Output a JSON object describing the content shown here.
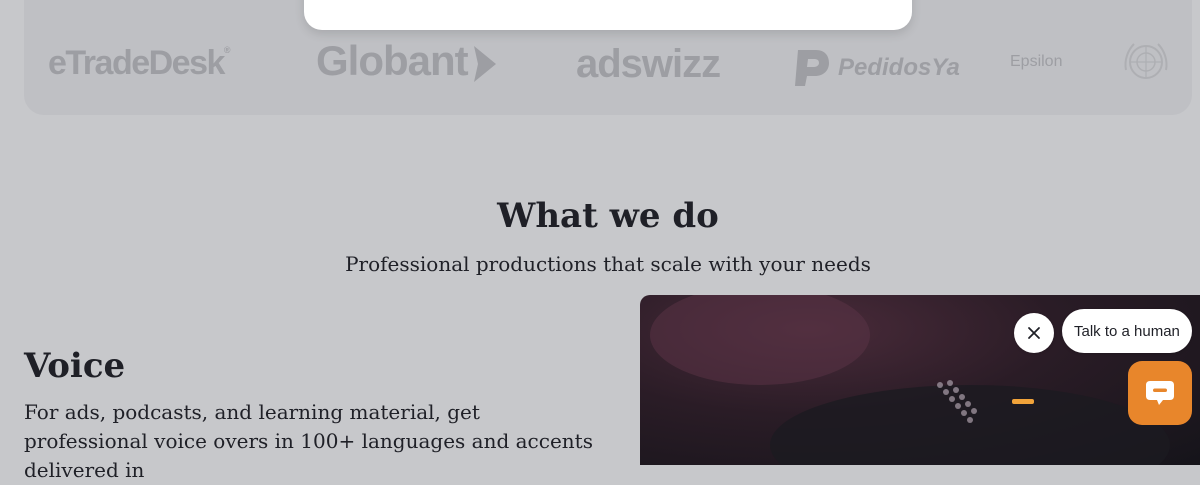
{
  "logos": {
    "trade_desk": "eTradeDesk",
    "trade_desk_mark": "®",
    "globant": "Globant",
    "adswizz": "adswizz",
    "pedidosya": "PedidosYa",
    "epsilon": "Epsilon",
    "un_icon": "un-emblem-icon"
  },
  "section": {
    "title": "What we do",
    "subtitle": "Professional productions that scale with your needs"
  },
  "voice": {
    "heading": "Voice",
    "description": "For ads, podcasts, and learning material, get professional voice overs in 100+ languages and accents delivered in"
  },
  "chat": {
    "prompt": "Talk to a human",
    "close_icon": "close-icon",
    "launcher_icon": "chat-bubble-icon",
    "launcher_color": "#e8862b"
  },
  "colors": {
    "background": "#c7c8cb",
    "logo_strip": "#bfc0c4",
    "logo_gray": "#9d9ea3",
    "text": "#1f2027"
  }
}
